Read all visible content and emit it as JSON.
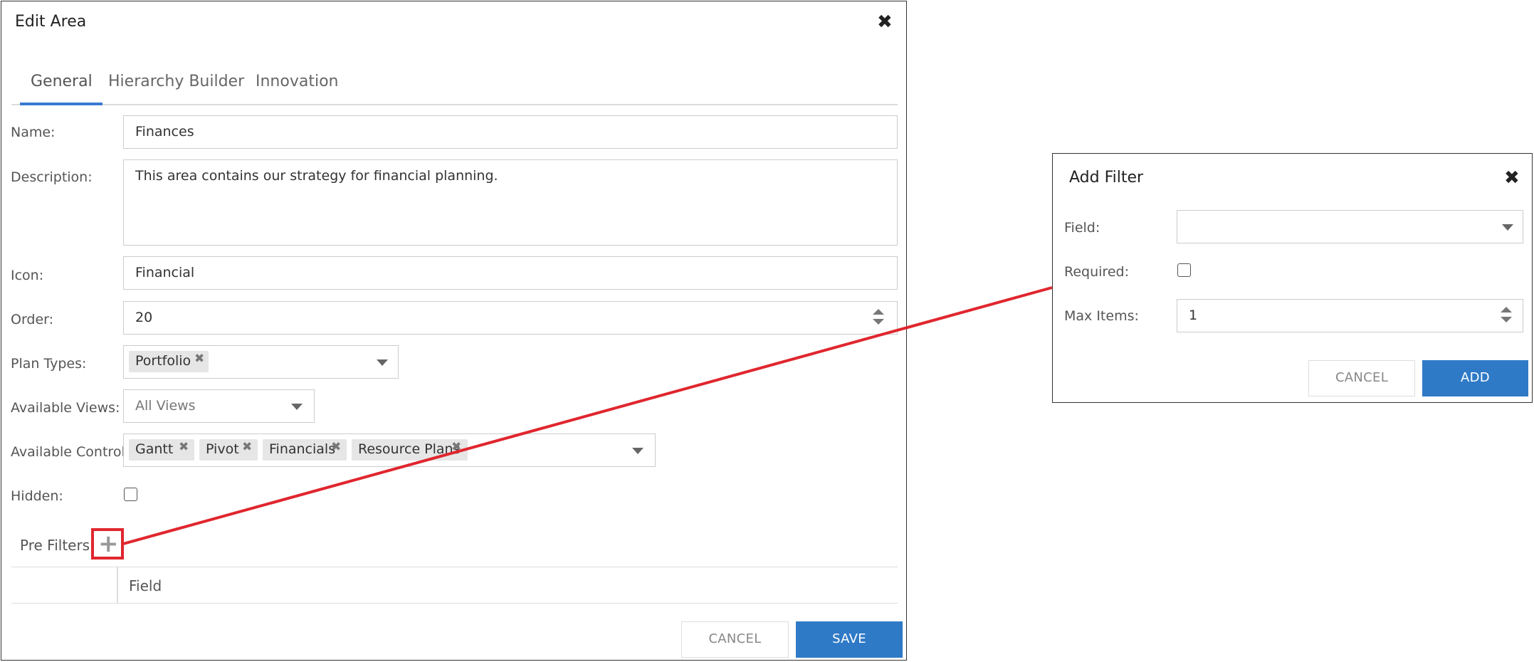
{
  "edit_area": {
    "title": "Edit Area",
    "tabs": [
      {
        "label": "General",
        "active": true
      },
      {
        "label": "Hierarchy Builder",
        "active": false
      },
      {
        "label": "Innovation",
        "active": false
      }
    ],
    "fields": {
      "name": {
        "label": "Name:",
        "value": "Finances"
      },
      "description": {
        "label": "Description:",
        "value": "This area contains our strategy for financial planning."
      },
      "icon": {
        "label": "Icon:",
        "value": "Financial"
      },
      "order": {
        "label": "Order:",
        "value": "20"
      },
      "plan_types": {
        "label": "Plan Types:",
        "chips": [
          "Portfolio"
        ]
      },
      "available_views": {
        "label": "Available Views:",
        "value": "All Views"
      },
      "available_controls": {
        "label": "Available Controls:",
        "chips": [
          "Gantt",
          "Pivot",
          "Financials",
          "Resource Plans"
        ]
      },
      "hidden": {
        "label": "Hidden:",
        "checked": false
      }
    },
    "pre_filters": {
      "label": "Pre Filters",
      "column_field": "Field"
    },
    "buttons": {
      "cancel": "CANCEL",
      "save": "SAVE"
    }
  },
  "add_filter": {
    "title": "Add Filter",
    "fields": {
      "field": {
        "label": "Field:",
        "value": ""
      },
      "required": {
        "label": "Required:",
        "checked": false
      },
      "max_items": {
        "label": "Max Items:",
        "value": "1"
      }
    },
    "buttons": {
      "cancel": "CANCEL",
      "add": "ADD"
    }
  },
  "icons": {
    "close": "close-icon",
    "remove": "remove-chip-icon",
    "add": "plus-icon",
    "dropdown": "chevron-down-icon"
  },
  "colors": {
    "accent": "#2f7ac7",
    "tab_ink": "#3b7ad1",
    "highlight": "#e0262e"
  }
}
